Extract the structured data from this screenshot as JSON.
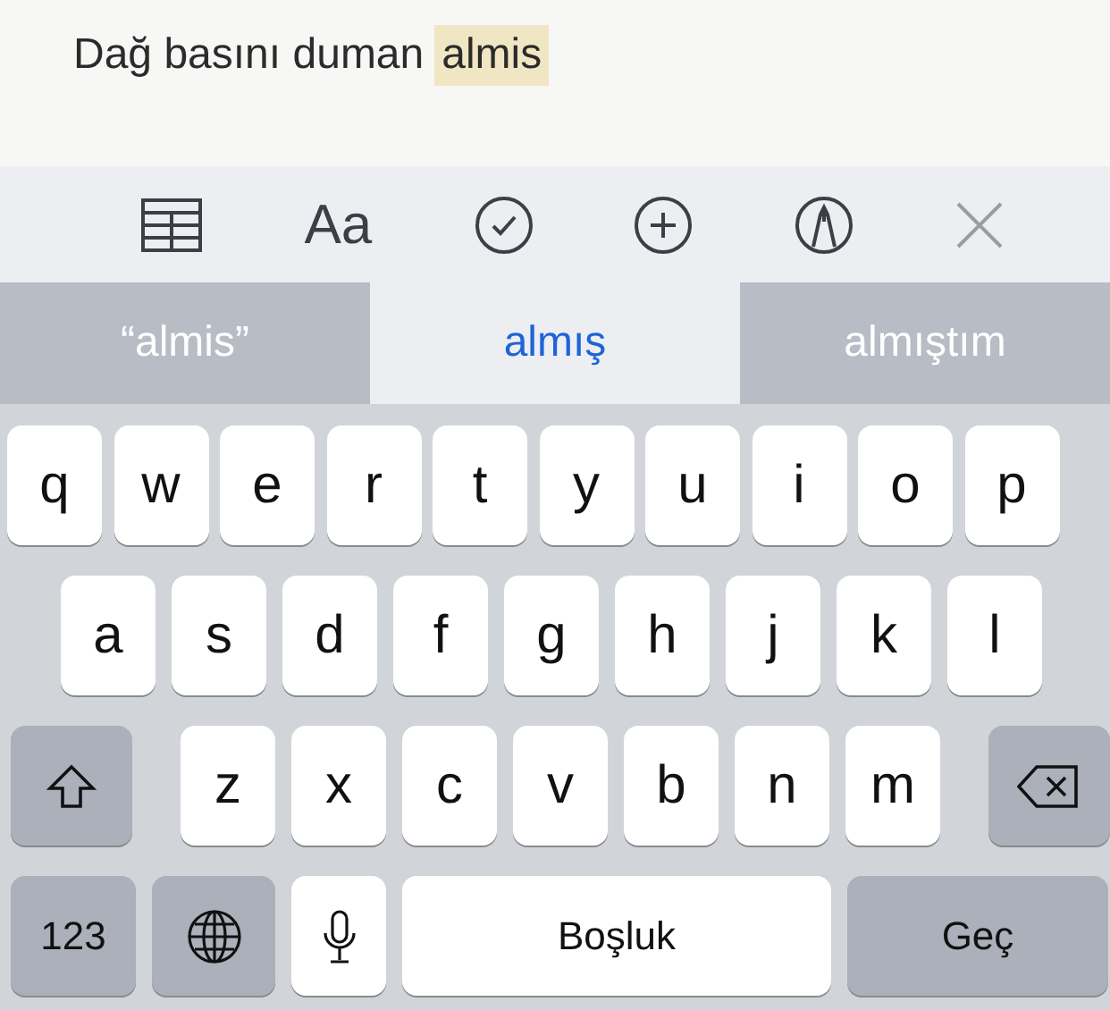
{
  "note": {
    "text": "Dağ basını duman",
    "marked_word": "almis"
  },
  "toolbar": [
    {
      "kind": "table"
    },
    {
      "kind": "format",
      "label": "Aa"
    },
    {
      "kind": "check"
    },
    {
      "kind": "add"
    },
    {
      "kind": "markup"
    },
    {
      "kind": "close"
    }
  ],
  "suggestions": [
    {
      "label": "“almis”",
      "selected": false
    },
    {
      "label": "almış",
      "selected": true
    },
    {
      "label": "almıştım",
      "selected": false
    }
  ],
  "keyboard": {
    "top_row": [
      {
        "kind": "letter",
        "label": "q"
      },
      {
        "kind": "letter",
        "label": "w"
      },
      {
        "kind": "letter",
        "label": "e"
      },
      {
        "kind": "letter",
        "label": "r"
      },
      {
        "kind": "letter",
        "label": "t"
      },
      {
        "kind": "letter",
        "label": "y"
      },
      {
        "kind": "letter",
        "label": "u"
      },
      {
        "kind": "letter",
        "label": "i"
      },
      {
        "kind": "letter",
        "label": "o"
      },
      {
        "kind": "letter",
        "label": "p"
      }
    ],
    "home_row": [
      {
        "kind": "letter",
        "label": "a"
      },
      {
        "kind": "letter",
        "label": "s"
      },
      {
        "kind": "letter",
        "label": "d"
      },
      {
        "kind": "letter",
        "label": "f"
      },
      {
        "kind": "letter",
        "label": "g"
      },
      {
        "kind": "letter",
        "label": "h"
      },
      {
        "kind": "letter",
        "label": "j"
      },
      {
        "kind": "letter",
        "label": "k"
      },
      {
        "kind": "letter",
        "label": "l"
      }
    ],
    "lower_row": [
      {
        "kind": "shift"
      },
      {
        "kind": "letter",
        "label": "z"
      },
      {
        "kind": "letter",
        "label": "x"
      },
      {
        "kind": "letter",
        "label": "c"
      },
      {
        "kind": "letter",
        "label": "v"
      },
      {
        "kind": "letter",
        "label": "b"
      },
      {
        "kind": "letter",
        "label": "n"
      },
      {
        "kind": "letter",
        "label": "m"
      },
      {
        "kind": "delete"
      }
    ],
    "bottom_row": [
      {
        "kind": "numbers",
        "label": "123"
      },
      {
        "kind": "globe"
      },
      {
        "kind": "mic"
      },
      {
        "kind": "space",
        "label": "Boşluk"
      },
      {
        "kind": "return",
        "label": "Geç"
      }
    ]
  }
}
